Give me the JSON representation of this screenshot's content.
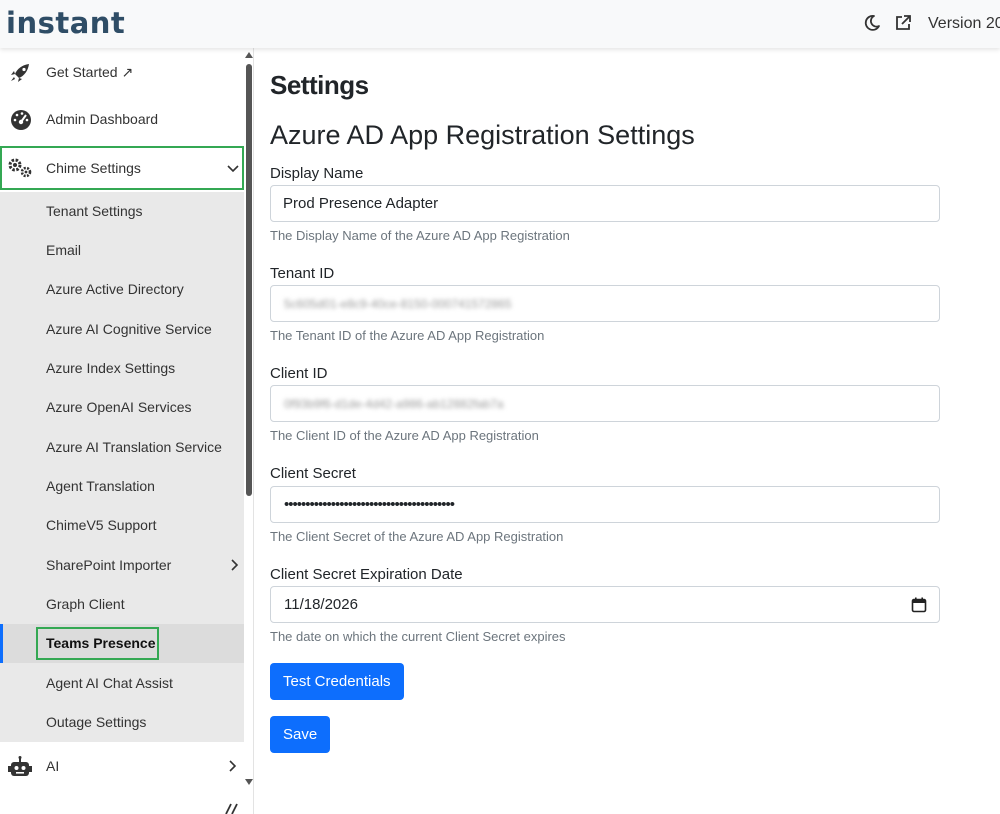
{
  "header": {
    "logo": "instant",
    "version": "Version 20",
    "icons": [
      "moon-icon",
      "external-link-icon"
    ]
  },
  "sidebar": {
    "top_items": [
      {
        "label": "Get Started ↗",
        "icon": "rocket-icon"
      },
      {
        "label": "Admin Dashboard",
        "icon": "dashboard-gauge-icon"
      },
      {
        "label": "Chime Settings",
        "icon": "gears-icon",
        "expanded": true
      }
    ],
    "sub_items": [
      {
        "label": "Tenant Settings"
      },
      {
        "label": "Email"
      },
      {
        "label": "Azure Active Directory"
      },
      {
        "label": "Azure AI Cognitive Service"
      },
      {
        "label": "Azure Index Settings"
      },
      {
        "label": "Azure OpenAI Services"
      },
      {
        "label": "Azure AI Translation Service"
      },
      {
        "label": "Agent Translation"
      },
      {
        "label": "ChimeV5 Support"
      },
      {
        "label": "SharePoint Importer",
        "has_children": true
      },
      {
        "label": "Graph Client"
      },
      {
        "label": "Teams Presence",
        "active": true
      },
      {
        "label": "Agent AI Chat Assist"
      },
      {
        "label": "Outage Settings"
      }
    ],
    "bottom_items": [
      {
        "label": "AI",
        "icon": "robot-icon",
        "has_children": true
      }
    ]
  },
  "main": {
    "page_title": "Settings",
    "section_title": "Azure AD App Registration Settings",
    "fields": {
      "display_name": {
        "label": "Display Name",
        "value": "Prod Presence Adapter",
        "help": "The Display Name of the Azure AD App Registration"
      },
      "tenant_id": {
        "label": "Tenant ID",
        "value": "5c605d01-e8c9-40ce-8150-000741572865",
        "help": "The Tenant ID of the Azure AD App Registration"
      },
      "client_id": {
        "label": "Client ID",
        "value": "0f93b9f6-d1de-4d42-a986-ab12882fab7a",
        "help": "The Client ID of the Azure AD App Registration"
      },
      "client_secret": {
        "label": "Client Secret",
        "value": "••••••••••••••••••••••••••••••••••••••••",
        "help": "The Client Secret of the Azure AD App Registration"
      },
      "expiration": {
        "label": "Client Secret Expiration Date",
        "value": "11/18/2026",
        "help": "The date on which the current Client Secret expires"
      }
    },
    "buttons": {
      "test": "Test Credentials",
      "save": "Save"
    }
  },
  "colors": {
    "primary": "#0d6efd",
    "highlight_border": "#34a853",
    "submenu_bg": "#e9e9e9",
    "logo": "#2f4d66"
  }
}
